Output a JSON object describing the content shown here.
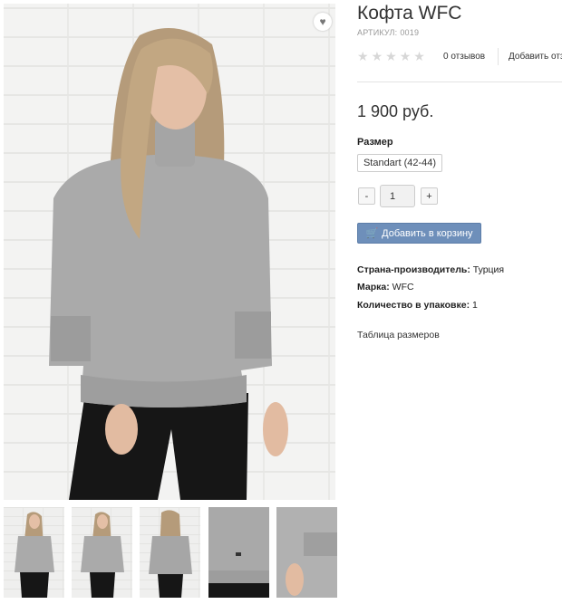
{
  "product": {
    "title": "Кофта WFC",
    "sku_label": "АРТИКУЛ:",
    "sku_value": "0019",
    "reviews": "0 отзывов",
    "add_review": "Добавить отзыв",
    "price": "1 900 руб.",
    "size_label": "Размер",
    "size_option": "Standart (42-44)",
    "qty_minus": "-",
    "qty_value": "1",
    "qty_plus": "+",
    "cart_button": "Добавить в корзину",
    "specs": [
      {
        "label": "Страна-производитель:",
        "value": "Турция"
      },
      {
        "label": "Марка:",
        "value": "WFC"
      },
      {
        "label": "Количество в упаковке:",
        "value": "1"
      }
    ],
    "size_table_link": "Таблица размеров"
  },
  "rating": {
    "stars_filled": 0,
    "stars_total": 5
  },
  "icons": {
    "wishlist": "heart-icon",
    "cart": "cart-icon",
    "star": "star-icon"
  },
  "colors": {
    "cart_button": "#6e8fba",
    "sweater": "#a9a9a9",
    "trousers": "#161616"
  }
}
